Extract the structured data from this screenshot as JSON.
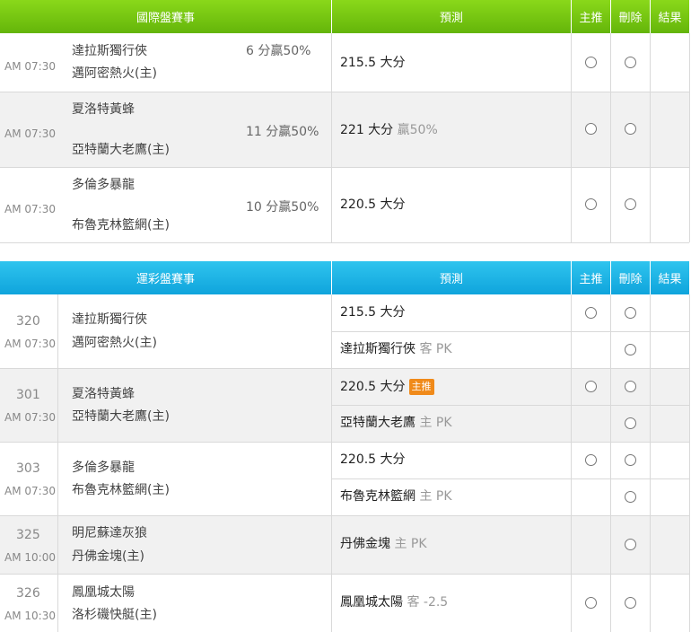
{
  "international": {
    "headers": {
      "match": "國際盤賽事",
      "prediction": "預測",
      "main_pick": "主推",
      "delete": "刪除",
      "result": "結果"
    },
    "rows": [
      {
        "time": "AM 07:30",
        "away": "達拉斯獨行俠",
        "home": "邁阿密熱火(主)",
        "handicap": "6 分贏50%",
        "pred_main": "215.5 大分",
        "pred_sub": ""
      },
      {
        "time": "AM 07:30",
        "away": "夏洛特黃蜂",
        "home": "亞特蘭大老鷹(主)",
        "handicap": "11 分贏50%",
        "pred_main": "221 大分",
        "pred_sub": "贏50%"
      },
      {
        "time": "AM 07:30",
        "away": "多倫多暴龍",
        "home": "布魯克林籃網(主)",
        "handicap": "10 分贏50%",
        "pred_main": "220.5 大分",
        "pred_sub": ""
      }
    ]
  },
  "sports_lottery": {
    "headers": {
      "match": "運彩盤賽事",
      "prediction": "預測",
      "main_pick": "主推",
      "delete": "刪除",
      "result": "結果"
    },
    "rows": [
      {
        "num": "320",
        "time": "AM 07:30",
        "away": "達拉斯獨行俠",
        "home": "邁阿密熱火(主)",
        "preds": [
          {
            "main": "215.5 大分",
            "sub": "",
            "tag": ""
          },
          {
            "main": "達拉斯獨行俠",
            "sub": "客 PK",
            "tag": ""
          }
        ]
      },
      {
        "num": "301",
        "time": "AM 07:30",
        "away": "夏洛特黃蜂",
        "home": "亞特蘭大老鷹(主)",
        "preds": [
          {
            "main": "220.5 大分",
            "sub": "",
            "tag": "主推"
          },
          {
            "main": "亞特蘭大老鷹",
            "sub": "主 PK",
            "tag": ""
          }
        ]
      },
      {
        "num": "303",
        "time": "AM 07:30",
        "away": "多倫多暴龍",
        "home": "布魯克林籃網(主)",
        "preds": [
          {
            "main": "220.5 大分",
            "sub": "",
            "tag": ""
          },
          {
            "main": "布魯克林籃網",
            "sub": "主 PK",
            "tag": ""
          }
        ]
      },
      {
        "num": "325",
        "time": "AM 10:00",
        "away": "明尼蘇達灰狼",
        "home": "丹佛金塊(主)",
        "preds": [
          {
            "main": "丹佛金塊",
            "sub": "主 PK",
            "tag": ""
          }
        ]
      },
      {
        "num": "326",
        "time": "AM 10:30",
        "away": "鳳凰城太陽",
        "home": "洛杉磯快艇(主)",
        "preds": [
          {
            "main": "鳳凰城太陽",
            "sub": "客 -2.5",
            "tag": ""
          }
        ]
      }
    ]
  }
}
